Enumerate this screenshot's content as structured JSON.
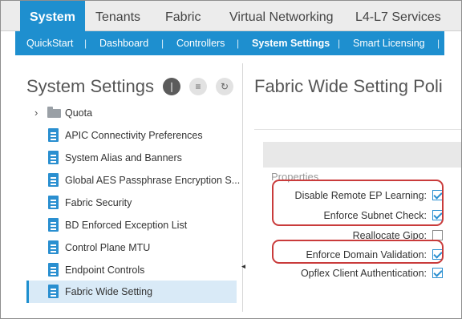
{
  "topnav": {
    "tabs": [
      {
        "label": "System",
        "active": true
      },
      {
        "label": "Tenants"
      },
      {
        "label": "Fabric"
      },
      {
        "label": "Virtual Networking"
      },
      {
        "label": "L4-L7 Services"
      }
    ]
  },
  "subnav": {
    "items": [
      {
        "label": "QuickStart"
      },
      {
        "label": "Dashboard"
      },
      {
        "label": "Controllers"
      },
      {
        "label": "System Settings",
        "active": true
      },
      {
        "label": "Smart Licensing"
      }
    ],
    "separator": "|"
  },
  "left": {
    "title": "System Settings",
    "tools": [
      "settings-icon",
      "collapse-icon",
      "refresh-icon"
    ],
    "tree": [
      {
        "label": "Quota",
        "icon": "folder-icon",
        "expandable": true
      },
      {
        "label": "APIC Connectivity Preferences",
        "icon": "doc-icon"
      },
      {
        "label": "System Alias and Banners",
        "icon": "doc-icon"
      },
      {
        "label": "Global AES Passphrase Encryption S...",
        "icon": "doc-icon"
      },
      {
        "label": "Fabric Security",
        "icon": "doc-icon"
      },
      {
        "label": "BD Enforced Exception List",
        "icon": "doc-icon"
      },
      {
        "label": "Control Plane MTU",
        "icon": "doc-icon"
      },
      {
        "label": "Endpoint Controls",
        "icon": "doc-icon"
      },
      {
        "label": "Fabric Wide Setting",
        "icon": "doc-icon",
        "selected": true
      }
    ]
  },
  "right": {
    "title": "Fabric Wide Setting Poli",
    "section": "Properties",
    "properties": [
      {
        "label": "Disable Remote EP Learning:",
        "checked": true
      },
      {
        "label": "Enforce Subnet Check:",
        "checked": true
      },
      {
        "label": "Reallocate Gipo:",
        "checked": false
      },
      {
        "label": "Enforce Domain Validation:",
        "checked": true
      },
      {
        "label": "Opflex Client Authentication:",
        "checked": true
      }
    ]
  },
  "colors": {
    "accent": "#1e8fcf",
    "highlight_border": "#c93b3b",
    "selected_row": "#d9eaf7"
  }
}
